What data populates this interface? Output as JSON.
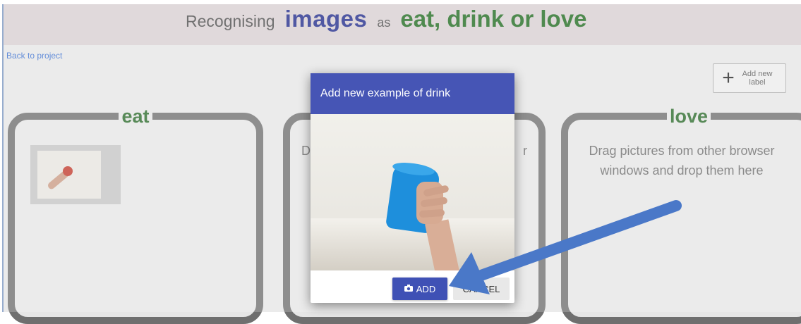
{
  "header": {
    "prefix": "Recognising",
    "type_word": "images",
    "joiner": "as",
    "labels_phrase": "eat, drink or love"
  },
  "nav": {
    "back_link": "Back to project"
  },
  "toolbar": {
    "add_label_plus": "+",
    "add_label_text": "Add new label"
  },
  "buckets": {
    "eat": {
      "title": "eat"
    },
    "drink": {
      "hint_left": "D",
      "hint_right": "r"
    },
    "love": {
      "title": "love",
      "hint": "Drag pictures from other browser windows and drop them here"
    }
  },
  "dialog": {
    "title": "Add new example of drink",
    "add_button": "ADD",
    "cancel_button": "CANCEL"
  },
  "colors": {
    "title_band": "#d8cfd1",
    "dialog_header": "#4655b5",
    "add_button": "#3f51b5",
    "bucket_title": "#2a6a2a",
    "arrow": "#4a78c8"
  },
  "icons": {
    "camera": "camera-icon",
    "plus": "plus-icon"
  }
}
